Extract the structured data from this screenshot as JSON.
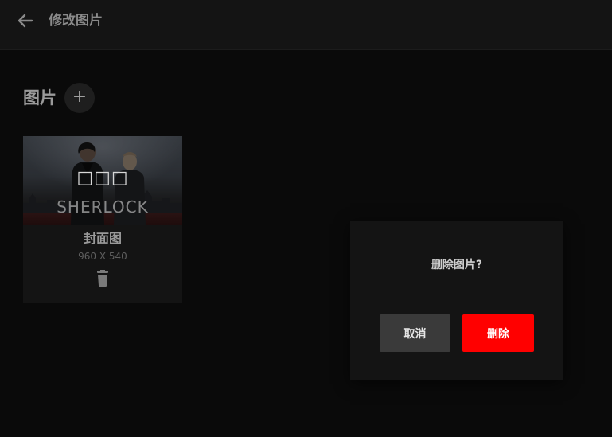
{
  "header": {
    "title": "修改图片",
    "back_icon": "arrow-left-icon"
  },
  "section": {
    "title": "图片",
    "add_label": "+"
  },
  "card": {
    "badge_text": "□□□",
    "logo_text": "SHERLOCK",
    "title": "封面图",
    "size": "960 X 540",
    "trash_icon": "trash-icon"
  },
  "dialog": {
    "message": "删除图片?",
    "cancel_label": "取消",
    "delete_label": "删除"
  },
  "colors": {
    "background": "#0a0a0a",
    "header_bg": "#141414",
    "danger": "#ff0000",
    "cancel_bg": "#3a3a3a"
  }
}
